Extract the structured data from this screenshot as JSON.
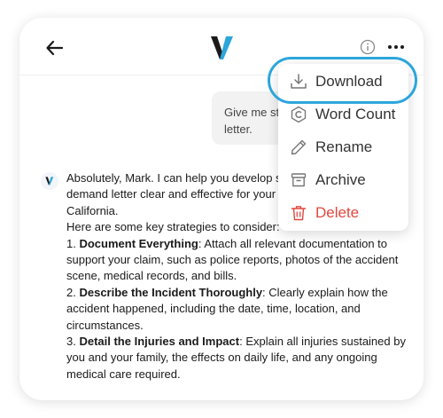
{
  "header": {
    "back_icon": "arrow-left-icon",
    "logo_icon": "v-logo-icon",
    "info_icon": "info-circle-icon",
    "more_icon": "more-horizontal-icon"
  },
  "user_message": "Give me strategies for my demand letter.",
  "assistant": {
    "intro": "Absolutely, Mark. I can help you develop strategies to make your demand letter clear and effective for your car accident claim in California.",
    "lead": "Here are some key strategies to consider:",
    "items": [
      {
        "num": "1.",
        "title": "Document Everything",
        "text": "Attach all relevant documentation to support your claim, such as police reports, photos of the accident scene, medical records, and bills."
      },
      {
        "num": "2.",
        "title": "Describe the Incident Thoroughly",
        "text": "Clearly explain how the accident happened, including the date, time, location, and circumstances."
      },
      {
        "num": "3.",
        "title": "Detail the Injuries and Impact",
        "text": "Explain all injuries sustained by you and your family, the effects on daily life, and any ongoing medical care required."
      }
    ]
  },
  "menu": {
    "items": [
      {
        "label": "Download",
        "icon": "download-icon"
      },
      {
        "label": "Word Count",
        "icon": "copyright-icon"
      },
      {
        "label": "Rename",
        "icon": "pencil-icon"
      },
      {
        "label": "Archive",
        "icon": "archive-box-icon"
      },
      {
        "label": "Delete",
        "icon": "trash-icon"
      }
    ]
  },
  "colors": {
    "accent": "#2ca6db",
    "logo_dark": "#1a1a1a",
    "logo_blue": "#2ca6db",
    "danger": "#e0473f",
    "bubble_bg": "#f2f2f2"
  }
}
